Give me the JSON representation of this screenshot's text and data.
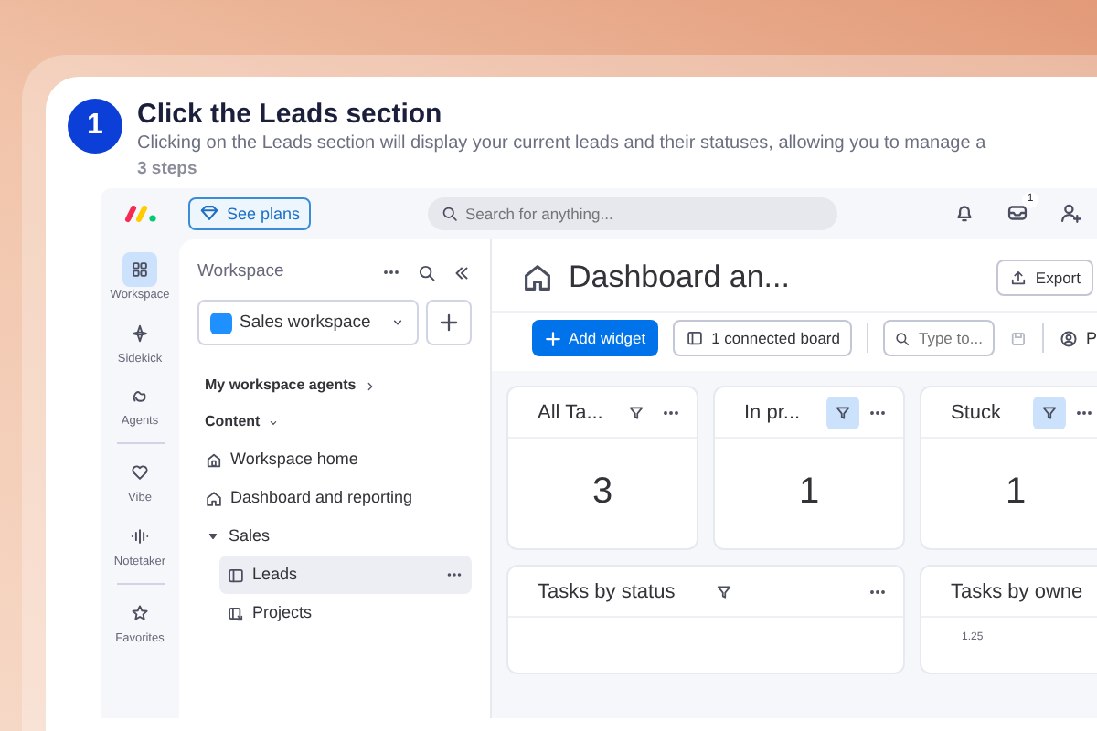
{
  "tutorial": {
    "step_number": "1",
    "title": "Click the Leads section",
    "description": "Clicking on the Leads section will display your current leads and their statuses, allowing you to manage a",
    "steps_count": "3 steps"
  },
  "app": {
    "top_bar": {
      "see_plans": "See plans",
      "search": {
        "placeholder": "Search for anything..."
      },
      "inbox_badge": "1"
    },
    "rail_groups": [
      {
        "items": [
          {
            "label": "Workspace",
            "selected": true
          },
          {
            "label": "Sidekick",
            "selected": false
          },
          {
            "label": "Agents",
            "selected": false
          }
        ]
      },
      {
        "items": [
          {
            "label": "Vibe",
            "selected": false
          },
          {
            "label": "Notetaker",
            "selected": false
          }
        ]
      },
      {
        "items": [
          {
            "label": "Favorites",
            "selected": false
          }
        ]
      }
    ],
    "sidebar": {
      "title": "Workspace",
      "workspace_selector": "Sales workspace",
      "agents_link": "My workspace agents",
      "content_label": "Content",
      "tree": [
        {
          "label": "Workspace home",
          "selected": false
        },
        {
          "label": "Dashboard and reporting",
          "selected": false
        },
        {
          "label": "Sales",
          "selected": false,
          "expanded": true,
          "children": [
            {
              "label": "Leads",
              "selected": true
            },
            {
              "label": "Projects",
              "selected": false
            }
          ]
        }
      ]
    },
    "dashboard": {
      "title": "Dashboard an...",
      "export": "Export",
      "add_widget": "Add widget",
      "connected_board": "1 connected board",
      "filter": {
        "placeholder": "Type to..."
      },
      "person_filter": "P",
      "widgets": [
        {
          "kind": "number",
          "title": "All Ta...",
          "filter_active": false,
          "value": "3"
        },
        {
          "kind": "number",
          "title": "In pr...",
          "filter_active": true,
          "value": "1"
        },
        {
          "kind": "number",
          "title": "Stuck",
          "filter_active": true,
          "value": "1"
        },
        {
          "kind": "chart",
          "title": "Tasks by status",
          "filter_active": false
        },
        {
          "kind": "chart",
          "title": "Tasks by owne",
          "y_tick": "1.25"
        }
      ]
    }
  }
}
